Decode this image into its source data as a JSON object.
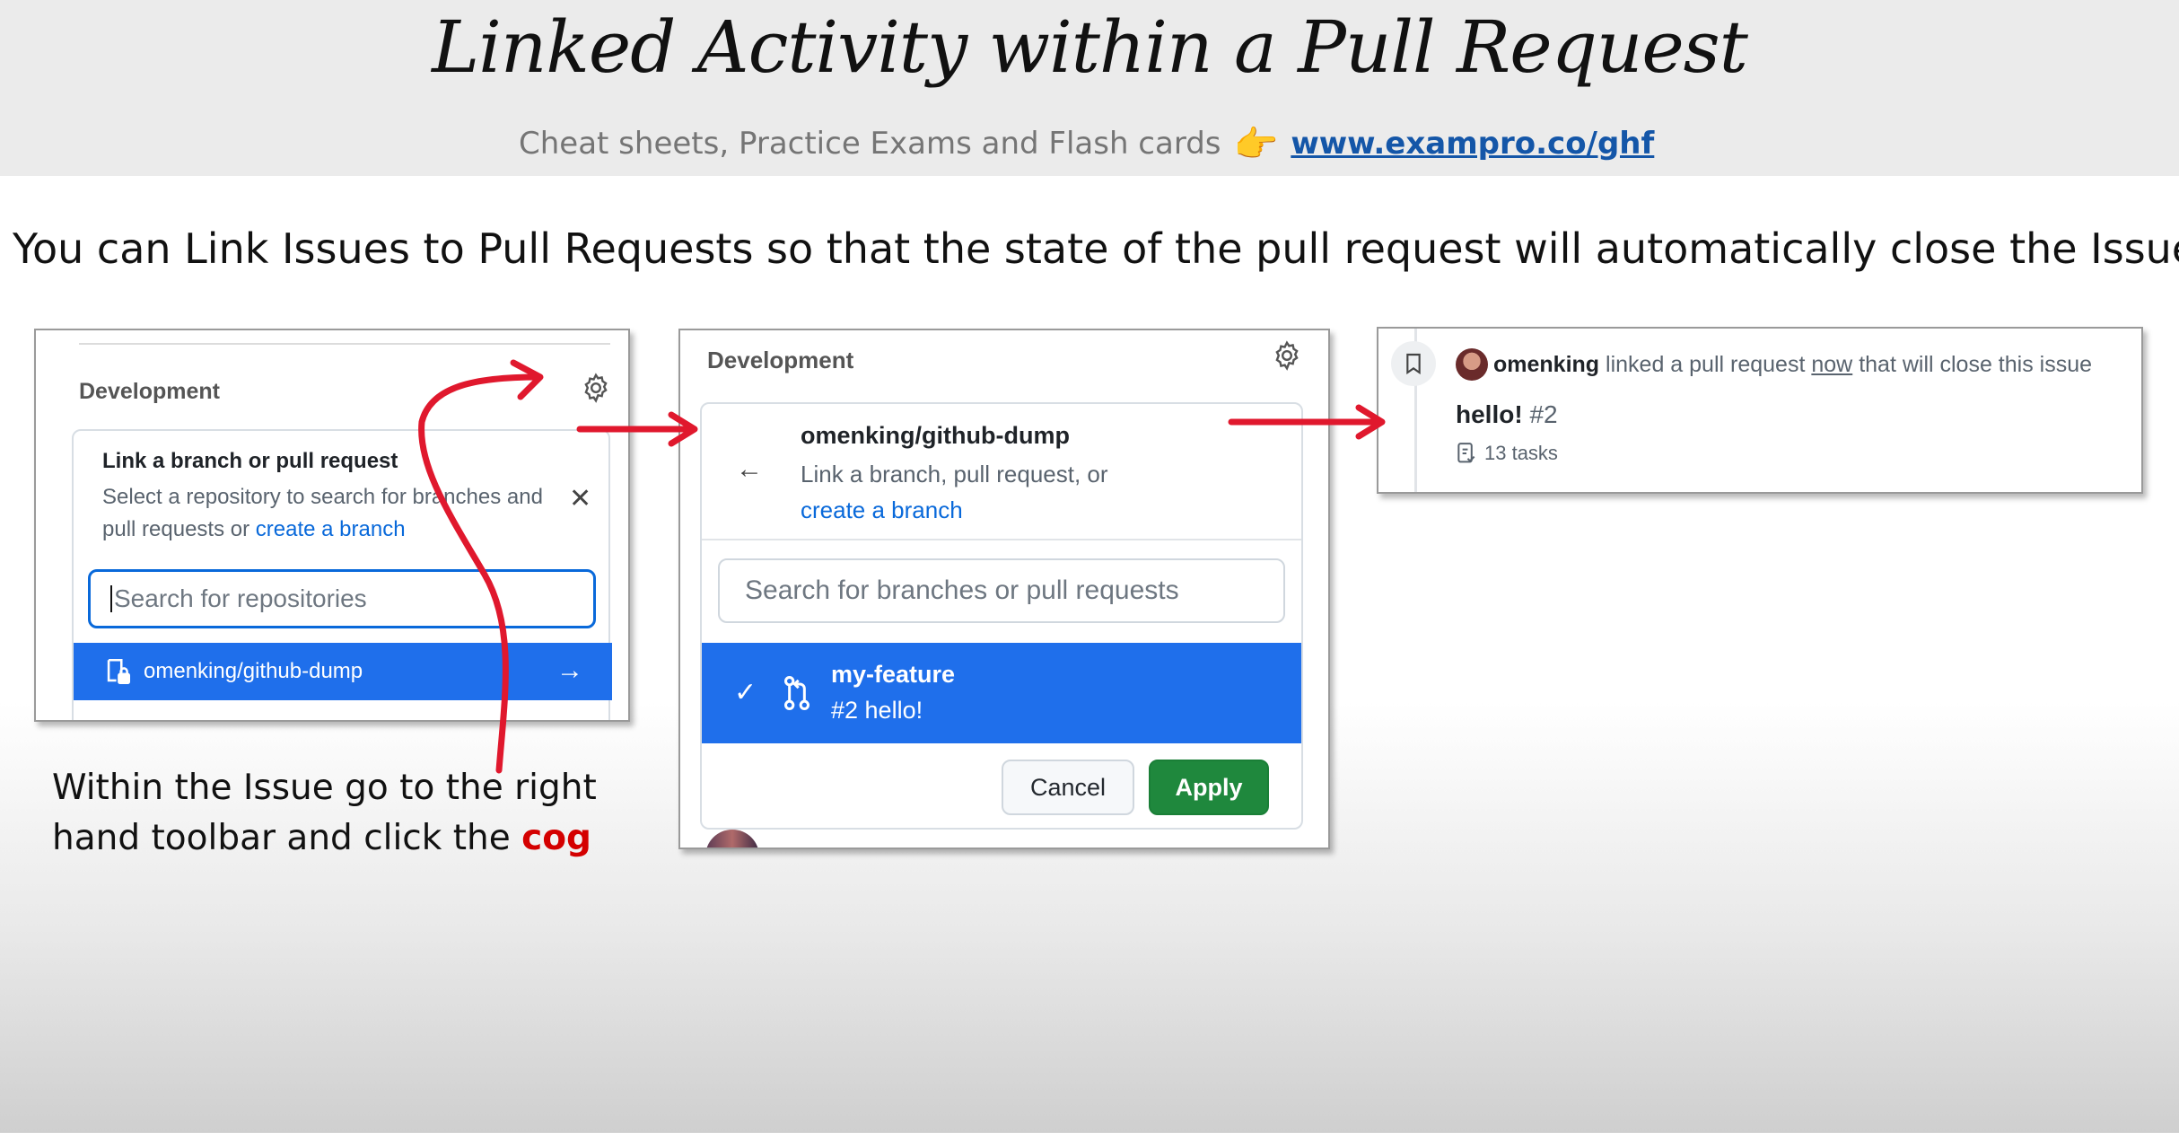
{
  "header": {
    "title": "Linked Activity within a Pull Request",
    "subtitle": "Cheat sheets, Practice Exams and Flash cards",
    "pointer_icon": "👉",
    "link": "www.exampro.co/ghf"
  },
  "lead": "You can Link Issues to Pull Requests so that the state of the pull request will automatically close the Issue",
  "panel1": {
    "section": "Development",
    "box_title": "Link a branch or pull request",
    "box_desc": "Select a repository to search for branches and pull requests or",
    "box_link": "create a branch",
    "search_placeholder": "Search for repositories",
    "repo": "omenking/github-dump"
  },
  "panel2": {
    "section": "Development",
    "repo": "omenking/github-dump",
    "desc": "Link a branch, pull request, or",
    "desc_link": "create a branch",
    "search_placeholder": "Search for branches or pull requests",
    "branch_name": "my-feature",
    "branch_sub": "#2 hello!",
    "cancel": "Cancel",
    "apply": "Apply"
  },
  "panel3": {
    "user": "omenking",
    "text_a": "linked a pull request",
    "text_now": "now",
    "text_b": "that will close this issue",
    "issue_title": "hello!",
    "issue_num": "#2",
    "tasks": "13 tasks"
  },
  "caption": {
    "text": "Within the Issue go to the right hand toolbar and click the",
    "highlight": "cog"
  },
  "colors": {
    "accent_blue": "#1f6feb",
    "apply_green": "#1f883d",
    "annotation_red": "#e0182d"
  }
}
